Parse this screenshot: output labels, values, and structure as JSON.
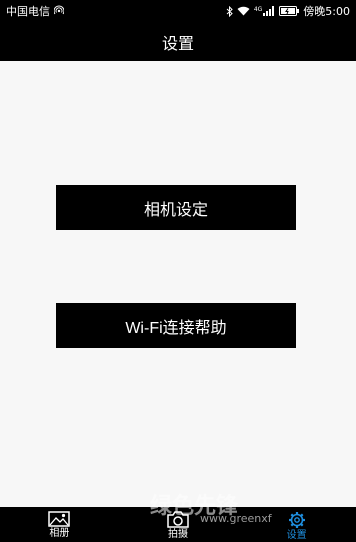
{
  "status_bar": {
    "carrier": "中国电信",
    "network_tag": "4G",
    "time": "傍晚5:00"
  },
  "header": {
    "title": "设置"
  },
  "buttons": {
    "camera_settings": "相机设定",
    "wifi_help": "Wi-Fi连接帮助"
  },
  "bottom_nav": {
    "tabs": [
      {
        "label": "相册",
        "icon": "image-icon",
        "active": false
      },
      {
        "label": "拍摄",
        "icon": "camera-icon",
        "active": false
      },
      {
        "label": "设置",
        "icon": "gear-icon",
        "active": true
      }
    ]
  },
  "watermark": {
    "text": "绿色先锋",
    "url": "www.greenxf"
  },
  "colors": {
    "bar": "#000000",
    "background": "#f7f7f7",
    "accent": "#1e8fe0"
  }
}
